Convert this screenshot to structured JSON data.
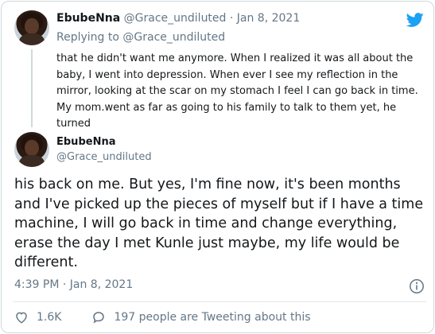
{
  "first_tweet": {
    "author_name": "EbubeNna",
    "author_meta": "@Grace_undiluted · Jan 8, 2021",
    "replying_prefix": "Replying to",
    "replying_handle": "@Grace_undiluted",
    "text": "that he didn't want me anymore. When I realized it was all about the baby, I went into depression. When ever I see my reflection in the mirror, looking at the scar on my stomach I feel I can go back in time. My mom.went as far as going to his family to talk to them yet, he turned"
  },
  "main_tweet": {
    "author_name": "EbubeNna",
    "author_handle": "@Grace_undiluted",
    "text": "his back on me. But yes, I'm fine now, it's been months and I've picked up the pieces of myself but if I have a time machine, I will go back in time and change everything, erase the day I met Kunle just maybe, my life would be different.",
    "timestamp": "4:39 PM · Jan 8, 2021"
  },
  "actions": {
    "like_count": "1.6K",
    "discussion_text": "197 people are Tweeting about this"
  },
  "icons": {
    "logo": "twitter-bird-icon",
    "info": "info-icon",
    "like": "heart-icon",
    "reply": "speech-bubble-icon"
  },
  "colors": {
    "twitter_blue": "#1da1f2",
    "secondary_text": "#657786",
    "border": "#cfd9de"
  }
}
